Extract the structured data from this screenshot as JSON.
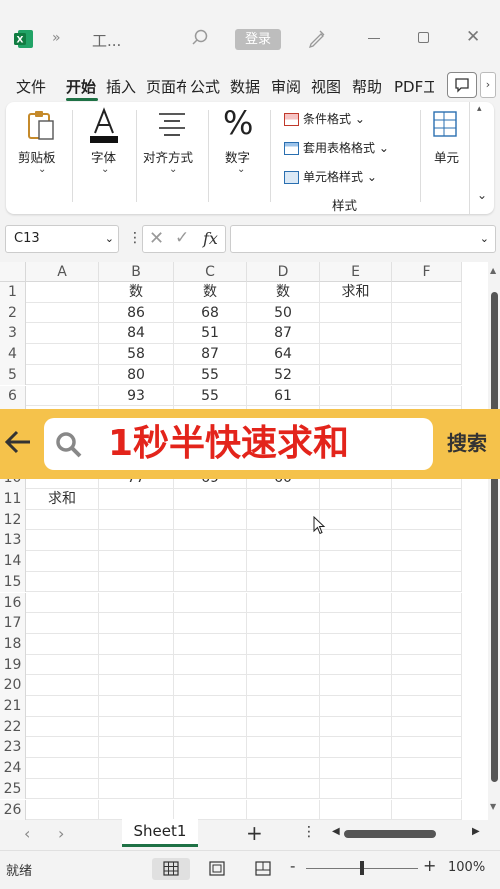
{
  "titlebar": {
    "app_title": "工...",
    "login_label": "登录"
  },
  "menu": {
    "tabs": [
      "文件",
      "开始",
      "插入",
      "页面布",
      "公式",
      "数据",
      "审阅",
      "视图",
      "帮助",
      "PDF工"
    ]
  },
  "ribbon": {
    "clipboard_label": "剪贴板",
    "font_label": "字体",
    "align_label": "对齐方式",
    "number_label": "数字",
    "cond_format_label": "条件格式",
    "table_format_label": "套用表格格式",
    "cell_style_label": "单元格样式",
    "styles_group_label": "样式",
    "cells_label": "单元"
  },
  "formula": {
    "name_box": "C13",
    "fx": "fx",
    "value": ""
  },
  "sheet": {
    "columns": [
      "A",
      "B",
      "C",
      "D",
      "E",
      "F"
    ],
    "rows": [
      {
        "num": "1",
        "cells": [
          "",
          "数",
          "数",
          "数",
          "求和",
          ""
        ]
      },
      {
        "num": "2",
        "cells": [
          "",
          "86",
          "68",
          "50",
          "",
          ""
        ]
      },
      {
        "num": "3",
        "cells": [
          "",
          "84",
          "51",
          "87",
          "",
          ""
        ]
      },
      {
        "num": "4",
        "cells": [
          "",
          "58",
          "87",
          "64",
          "",
          ""
        ]
      },
      {
        "num": "5",
        "cells": [
          "",
          "80",
          "55",
          "52",
          "",
          ""
        ]
      },
      {
        "num": "6",
        "cells": [
          "",
          "93",
          "55",
          "61",
          "",
          ""
        ]
      },
      {
        "num": "7",
        "cells": [
          "",
          "",
          "",
          "",
          "",
          ""
        ]
      },
      {
        "num": "8",
        "cells": [
          "",
          "",
          "",
          "",
          "",
          ""
        ]
      },
      {
        "num": "9",
        "cells": [
          "",
          "",
          "",
          "",
          "",
          ""
        ]
      },
      {
        "num": "10",
        "cells": [
          "",
          "77",
          "69",
          "60",
          "",
          ""
        ]
      },
      {
        "num": "11",
        "cells": [
          "求和",
          "",
          "",
          "",
          "",
          ""
        ]
      },
      {
        "num": "12",
        "cells": [
          "",
          "",
          "",
          "",
          "",
          ""
        ]
      },
      {
        "num": "13",
        "cells": [
          "",
          "",
          "",
          "",
          "",
          ""
        ]
      },
      {
        "num": "14",
        "cells": [
          "",
          "",
          "",
          "",
          "",
          ""
        ]
      },
      {
        "num": "15",
        "cells": [
          "",
          "",
          "",
          "",
          "",
          ""
        ]
      },
      {
        "num": "16",
        "cells": [
          "",
          "",
          "",
          "",
          "",
          ""
        ]
      },
      {
        "num": "17",
        "cells": [
          "",
          "",
          "",
          "",
          "",
          ""
        ]
      },
      {
        "num": "18",
        "cells": [
          "",
          "",
          "",
          "",
          "",
          ""
        ]
      },
      {
        "num": "19",
        "cells": [
          "",
          "",
          "",
          "",
          "",
          ""
        ]
      },
      {
        "num": "20",
        "cells": [
          "",
          "",
          "",
          "",
          "",
          ""
        ]
      },
      {
        "num": "21",
        "cells": [
          "",
          "",
          "",
          "",
          "",
          ""
        ]
      },
      {
        "num": "22",
        "cells": [
          "",
          "",
          "",
          "",
          "",
          ""
        ]
      },
      {
        "num": "23",
        "cells": [
          "",
          "",
          "",
          "",
          "",
          ""
        ]
      },
      {
        "num": "24",
        "cells": [
          "",
          "",
          "",
          "",
          "",
          ""
        ]
      },
      {
        "num": "25",
        "cells": [
          "",
          "",
          "",
          "",
          "",
          ""
        ]
      },
      {
        "num": "26",
        "cells": [
          "",
          "",
          "",
          "",
          "",
          ""
        ]
      }
    ]
  },
  "overlay": {
    "search_text": "1秒半快速求和",
    "search_button": "搜索",
    "text_color": "#e3241b",
    "bar_color": "#f5c24b"
  },
  "sheettabs": {
    "active_sheet": "Sheet1",
    "add_label": "+"
  },
  "statusbar": {
    "status": "就绪",
    "zoom": "100%",
    "minus": "-",
    "plus": "+"
  },
  "colors": {
    "accent": "#1e7145"
  }
}
